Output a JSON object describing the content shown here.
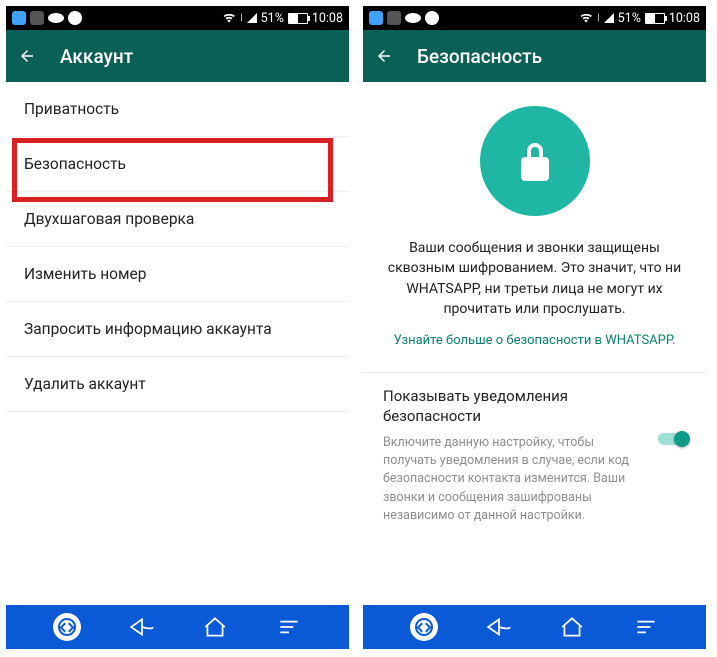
{
  "statusbar": {
    "battery_percent": "51%",
    "time": "10:08"
  },
  "left_screen": {
    "header_title": "Аккаунт",
    "items": [
      "Приватность",
      "Безопасность",
      "Двухшаговая проверка",
      "Изменить номер",
      "Запросить информацию аккаунта",
      "Удалить аккаунт"
    ]
  },
  "right_screen": {
    "header_title": "Безопасность",
    "description": "Ваши сообщения и звонки защищены сквозным шифрованием. Это значит, что ни WHATSAPP, ни третьи лица не могут их прочитать или прослушать.",
    "link": "Узнайте больше о безопасности в WHATSAPP.",
    "setting_title": "Показывать уведомления безопасности",
    "setting_sub": "Включите данную настройку, чтобы получать уведомления в случае, если код безопасности контакта изменится. Ваши звонки и сообщения зашифрованы независимо от данной настройки.",
    "toggle_on": true
  },
  "colors": {
    "header_bg": "#0b6055",
    "accent": "#1fb7a3",
    "link": "#0a8170",
    "navbar": "#0a59d6",
    "highlight": "#d92124"
  }
}
